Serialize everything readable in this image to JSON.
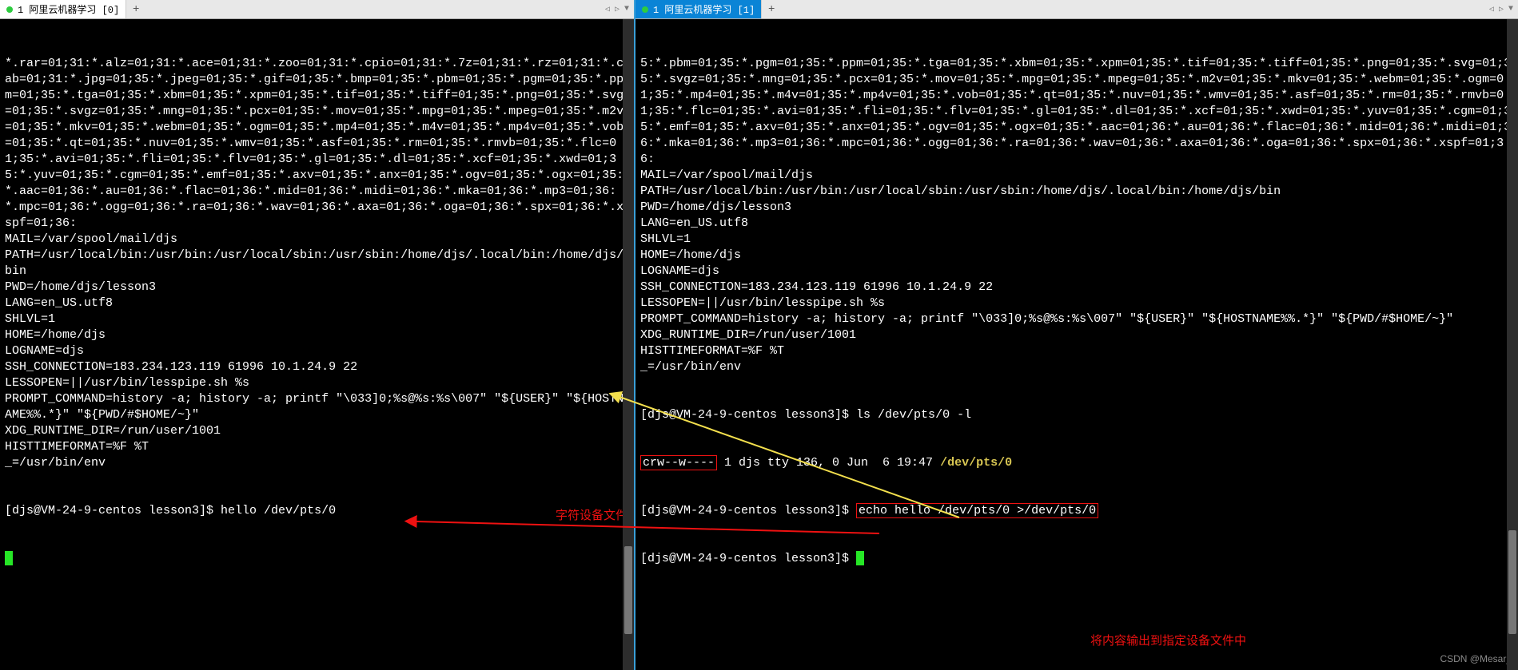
{
  "left": {
    "tab_title": "1 阿里云机器学习 [0]",
    "nav_left": "◁",
    "nav_right": "▷",
    "nav_down": "▼",
    "body": "*.rar=01;31:*.alz=01;31:*.ace=01;31:*.zoo=01;31:*.cpio=01;31:*.7z=01;31:*.rz=01;31:*.cab=01;31:*.jpg=01;35:*.jpeg=01;35:*.gif=01;35:*.bmp=01;35:*.pbm=01;35:*.pgm=01;35:*.ppm=01;35:*.tga=01;35:*.xbm=01;35:*.xpm=01;35:*.tif=01;35:*.tiff=01;35:*.png=01;35:*.svg=01;35:*.svgz=01;35:*.mng=01;35:*.pcx=01;35:*.mov=01;35:*.mpg=01;35:*.mpeg=01;35:*.m2v=01;35:*.mkv=01;35:*.webm=01;35:*.ogm=01;35:*.mp4=01;35:*.m4v=01;35:*.mp4v=01;35:*.vob=01;35:*.qt=01;35:*.nuv=01;35:*.wmv=01;35:*.asf=01;35:*.rm=01;35:*.rmvb=01;35:*.flc=01;35:*.avi=01;35:*.fli=01;35:*.flv=01;35:*.gl=01;35:*.dl=01;35:*.xcf=01;35:*.xwd=01;35:*.yuv=01;35:*.cgm=01;35:*.emf=01;35:*.axv=01;35:*.anx=01;35:*.ogv=01;35:*.ogx=01;35:*.aac=01;36:*.au=01;36:*.flac=01;36:*.mid=01;36:*.midi=01;36:*.mka=01;36:*.mp3=01;36:*.mpc=01;36:*.ogg=01;36:*.ra=01;36:*.wav=01;36:*.axa=01;36:*.oga=01;36:*.spx=01;36:*.xspf=01;36:\nMAIL=/var/spool/mail/djs\nPATH=/usr/local/bin:/usr/bin:/usr/local/sbin:/usr/sbin:/home/djs/.local/bin:/home/djs/bin\nPWD=/home/djs/lesson3\nLANG=en_US.utf8\nSHLVL=1\nHOME=/home/djs\nLOGNAME=djs\nSSH_CONNECTION=183.234.123.119 61996 10.1.24.9 22\nLESSOPEN=||/usr/bin/lesspipe.sh %s\nPROMPT_COMMAND=history -a; history -a; printf \"\\033]0;%s@%s:%s\\007\" \"${USER}\" \"${HOSTNAME%%.*}\" \"${PWD/#$HOME/~}\"\nXDG_RUNTIME_DIR=/run/user/1001\nHISTTIMEFORMAT=%F %T\n_=/usr/bin/env",
    "prompt": "[djs@VM-24-9-centos lesson3]$ ",
    "prompt_output": "hello /dev/pts/0"
  },
  "right": {
    "tab_title": "1 阿里云机器学习 [1]",
    "nav_left": "◁",
    "nav_right": "▷",
    "nav_down": "▼",
    "body": "5:*.pbm=01;35:*.pgm=01;35:*.ppm=01;35:*.tga=01;35:*.xbm=01;35:*.xpm=01;35:*.tif=01;35:*.tiff=01;35:*.png=01;35:*.svg=01;35:*.svgz=01;35:*.mng=01;35:*.pcx=01;35:*.mov=01;35:*.mpg=01;35:*.mpeg=01;35:*.m2v=01;35:*.mkv=01;35:*.webm=01;35:*.ogm=01;35:*.mp4=01;35:*.m4v=01;35:*.mp4v=01;35:*.vob=01;35:*.qt=01;35:*.nuv=01;35:*.wmv=01;35:*.asf=01;35:*.rm=01;35:*.rmvb=01;35:*.flc=01;35:*.avi=01;35:*.fli=01;35:*.flv=01;35:*.gl=01;35:*.dl=01;35:*.xcf=01;35:*.xwd=01;35:*.yuv=01;35:*.cgm=01;35:*.emf=01;35:*.axv=01;35:*.anx=01;35:*.ogv=01;35:*.ogx=01;35:*.aac=01;36:*.au=01;36:*.flac=01;36:*.mid=01;36:*.midi=01;36:*.mka=01;36:*.mp3=01;36:*.mpc=01;36:*.ogg=01;36:*.ra=01;36:*.wav=01;36:*.axa=01;36:*.oga=01;36:*.spx=01;36:*.xspf=01;36:\nMAIL=/var/spool/mail/djs\nPATH=/usr/local/bin:/usr/bin:/usr/local/sbin:/usr/sbin:/home/djs/.local/bin:/home/djs/bin\nPWD=/home/djs/lesson3\nLANG=en_US.utf8\nSHLVL=1\nHOME=/home/djs\nLOGNAME=djs\nSSH_CONNECTION=183.234.123.119 61996 10.1.24.9 22\nLESSOPEN=||/usr/bin/lesspipe.sh %s\nPROMPT_COMMAND=history -a; history -a; printf \"\\033]0;%s@%s:%s\\007\" \"${USER}\" \"${HOSTNAME%%.*}\" \"${PWD/#$HOME/~}\"\nXDG_RUNTIME_DIR=/run/user/1001\nHISTTIMEFORMAT=%F %T\n_=/usr/bin/env",
    "cmd1_prompt": "[djs@VM-24-9-centos lesson3]$ ",
    "cmd1": "ls /dev/pts/0 -l",
    "ls_perm": "crw--w----",
    "ls_mid": " 1 djs tty 136, 0 Jun  6 19:47 ",
    "ls_path": "/dev/pts/0",
    "cmd2_prompt": "[djs@VM-24-9-centos lesson3]$ ",
    "cmd2": "echo hello /dev/pts/0 >/dev/pts/0",
    "cmd3_prompt": "[djs@VM-24-9-centos lesson3]$ "
  },
  "annot": {
    "char_dev": "字符设备文件",
    "out_to": "将内容输出到指定设备文件中"
  },
  "watermark": "CSDN @Mesar_"
}
